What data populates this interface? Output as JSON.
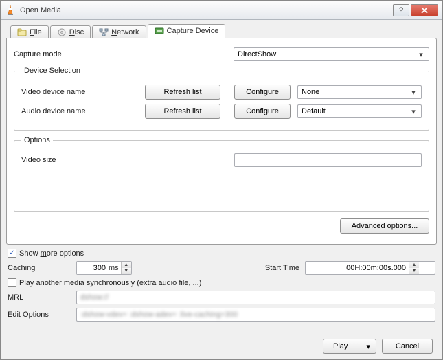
{
  "window": {
    "title": "Open Media"
  },
  "tabs": {
    "file": "File",
    "disc": "Disc",
    "network": "Network",
    "capture": "Capture Device"
  },
  "capture": {
    "mode_label": "Capture mode",
    "mode_value": "DirectShow",
    "device_selection_legend": "Device Selection",
    "video_device_label": "Video device name",
    "audio_device_label": "Audio device name",
    "refresh_label": "Refresh list",
    "configure_label": "Configure",
    "video_device_value": "None",
    "audio_device_value": "Default",
    "options_legend": "Options",
    "video_size_label": "Video size",
    "video_size_value": "",
    "advanced_label": "Advanced options..."
  },
  "more": {
    "show_more_label": "Show more options",
    "show_more_checked": true,
    "caching_label": "Caching",
    "caching_value": "300",
    "caching_unit": "ms",
    "start_time_label": "Start Time",
    "start_time_value": "00H:00m:00s.000",
    "sync_label": "Play another media synchronously (extra audio file, ...)",
    "sync_checked": false,
    "mrl_label": "MRL",
    "mrl_value": "dshow://",
    "edit_label": "Edit Options",
    "edit_value": ":dshow-vdev= :dshow-adev= :live-caching=300"
  },
  "footer": {
    "play": "Play",
    "cancel": "Cancel"
  }
}
